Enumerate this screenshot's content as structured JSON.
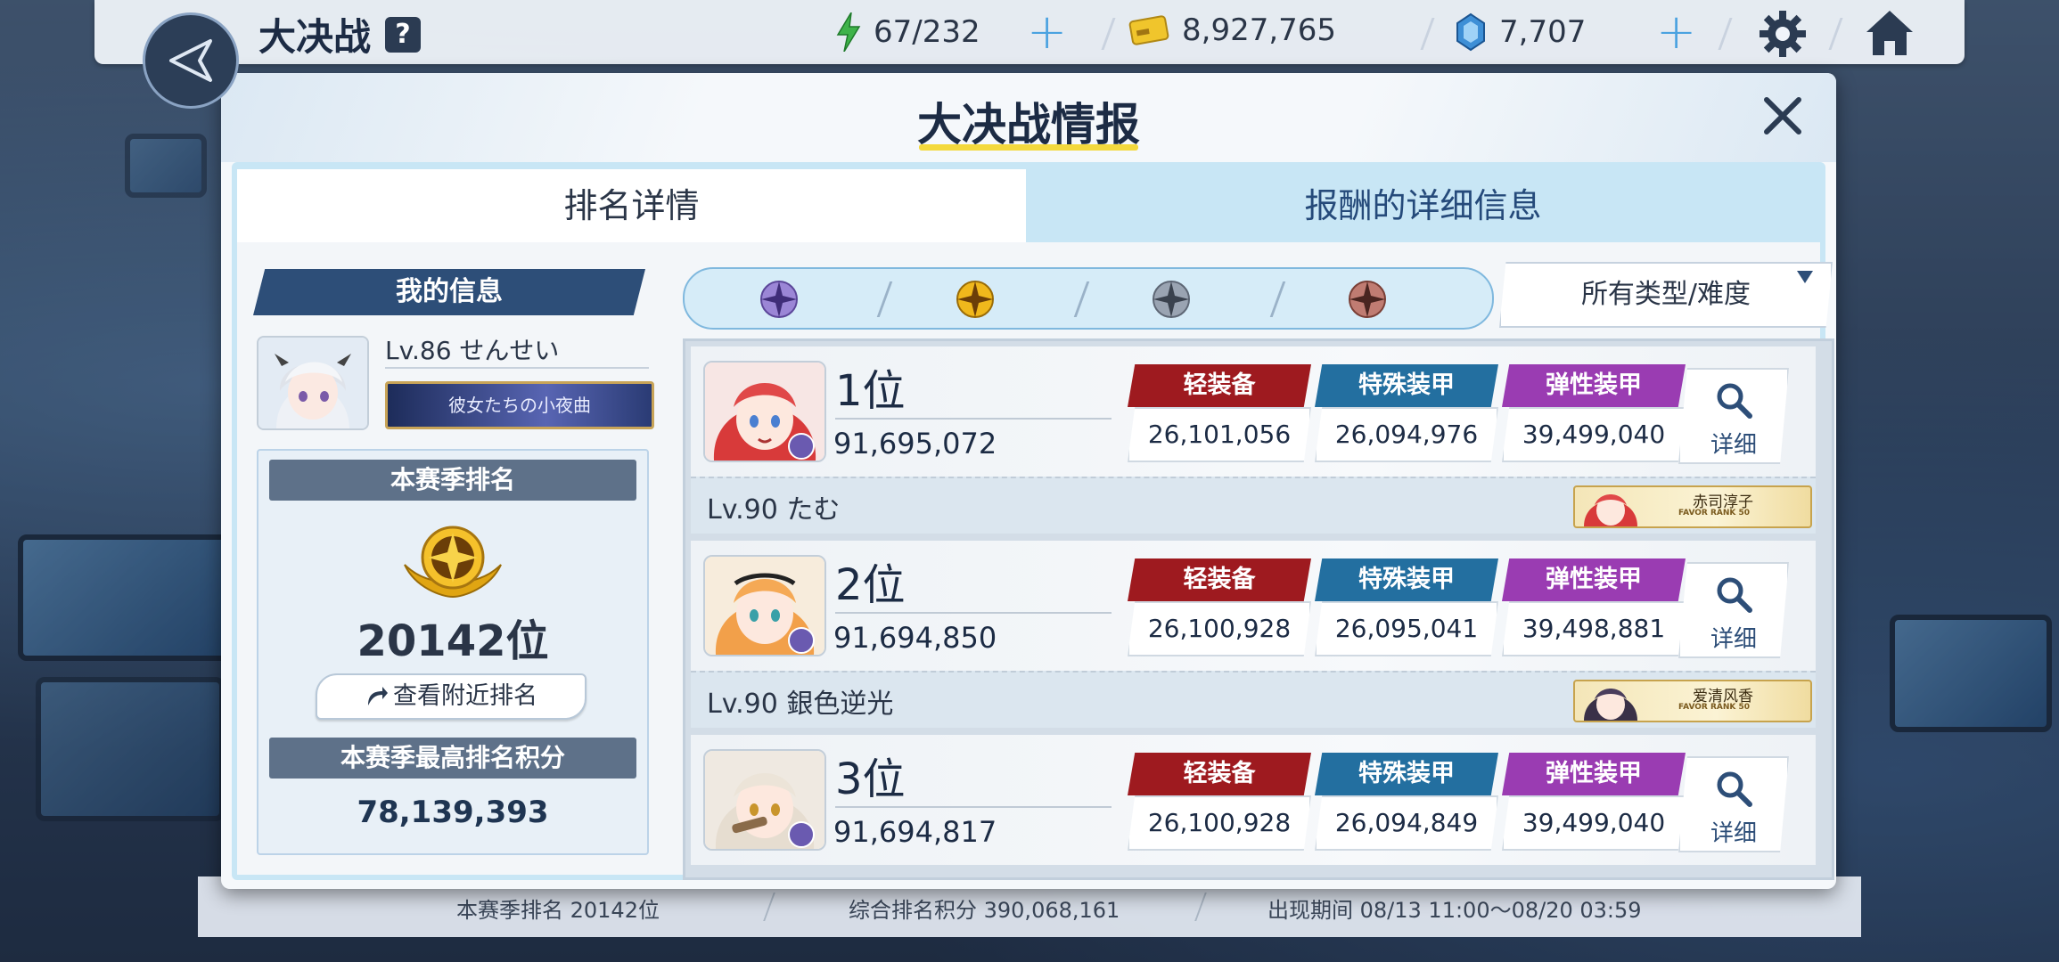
{
  "topbar": {
    "title": "大决战",
    "help": "?",
    "energy": "67/232",
    "credits": "8,927,765",
    "gems": "7,707"
  },
  "modal": {
    "title": "大决战情报",
    "tabs": [
      {
        "label": "排名详情",
        "active": true
      },
      {
        "label": "报酬的详细信息",
        "active": false
      }
    ]
  },
  "my_info": {
    "header": "我的信息",
    "level_name": "Lv.86 せんせい",
    "banner_text": "彼女たちの小夜曲",
    "season_rank_header": "本赛季排名",
    "season_rank": "20142位",
    "nearby_button": "查看附近排名",
    "best_score_header": "本赛季最高排名积分",
    "best_score": "78,139,393"
  },
  "filter": {
    "difficulties": [
      {
        "name": "platinum-tier-icon",
        "color": "#8a6cc8",
        "selected": false
      },
      {
        "name": "gold-tier-icon",
        "color": "#e8b21a",
        "selected": true
      },
      {
        "name": "silver-tier-icon",
        "color": "#8a95a3",
        "selected": false
      },
      {
        "name": "bronze-tier-icon",
        "color": "#b06a60",
        "selected": false
      }
    ],
    "type_dropdown": "所有类型/难度"
  },
  "armor_labels": {
    "light": "轻装备",
    "special": "特殊装甲",
    "elastic": "弹性装甲"
  },
  "armor_colors": {
    "light": "#9e1a1f",
    "special": "#236fa0",
    "elastic": "#9a3cb2"
  },
  "detail_label": "详细",
  "rankings": [
    {
      "rank": "1位",
      "score": "91,695,072",
      "light": "26,101,056",
      "special": "26,094,976",
      "elastic": "39,499,040",
      "level_name": "Lv.90  たむ",
      "student": "赤司淳子",
      "favor": "FAVOR RANK 50"
    },
    {
      "rank": "2位",
      "score": "91,694,850",
      "light": "26,100,928",
      "special": "26,095,041",
      "elastic": "39,498,881",
      "level_name": "Lv.90  銀色逆光",
      "student": "爱清风香",
      "favor": "FAVOR RANK 50"
    },
    {
      "rank": "3位",
      "score": "91,694,817",
      "light": "26,100,928",
      "special": "26,094,849",
      "elastic": "39,499,040"
    }
  ],
  "bottom_bar": {
    "season_rank": "本赛季排名  20142位",
    "total_score": "综合排名积分  390,068,161",
    "period": "出现期间  08/13 11:00～08/20 03:59"
  }
}
